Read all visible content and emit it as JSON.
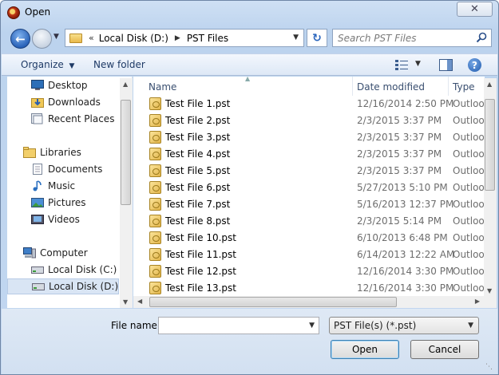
{
  "window": {
    "title": "Open",
    "close_label": "✕"
  },
  "address_bar": {
    "prefix": "«",
    "segments": [
      "Local Disk (D:)",
      "PST Files"
    ]
  },
  "search": {
    "placeholder": "Search PST Files"
  },
  "toolbar": {
    "organize_label": "Organize",
    "new_folder_label": "New folder",
    "help_label": "?"
  },
  "nav": {
    "favorites": [
      {
        "label": "Desktop",
        "icon": "desktop-icon"
      },
      {
        "label": "Downloads",
        "icon": "downloads-icon"
      },
      {
        "label": "Recent Places",
        "icon": "recent-places-icon"
      }
    ],
    "libraries": {
      "label": "Libraries",
      "items": [
        {
          "label": "Documents",
          "icon": "documents-icon"
        },
        {
          "label": "Music",
          "icon": "music-icon"
        },
        {
          "label": "Pictures",
          "icon": "pictures-icon"
        },
        {
          "label": "Videos",
          "icon": "videos-icon"
        }
      ]
    },
    "computer": {
      "label": "Computer",
      "items": [
        {
          "label": "Local Disk (C:)",
          "icon": "drive-icon"
        },
        {
          "label": "Local Disk (D:)",
          "icon": "drive-icon",
          "selected": true
        }
      ]
    }
  },
  "file_list": {
    "columns": [
      "Name",
      "Date modified",
      "Type"
    ],
    "rows": [
      {
        "name": "Test File 1.pst",
        "date": "12/16/2014 2:50 PM",
        "type": "Outloo"
      },
      {
        "name": "Test File 2.pst",
        "date": "2/3/2015 3:37 PM",
        "type": "Outloo"
      },
      {
        "name": "Test File 3.pst",
        "date": "2/3/2015 3:37 PM",
        "type": "Outloo"
      },
      {
        "name": "Test File 4.pst",
        "date": "2/3/2015 3:37 PM",
        "type": "Outloo"
      },
      {
        "name": "Test File 5.pst",
        "date": "2/3/2015 3:37 PM",
        "type": "Outloo"
      },
      {
        "name": "Test File 6.pst",
        "date": "5/27/2013 5:10 PM",
        "type": "Outloo"
      },
      {
        "name": "Test File 7.pst",
        "date": "5/16/2013 12:37 PM",
        "type": "Outloo"
      },
      {
        "name": "Test File 8.pst",
        "date": "2/3/2015 5:14 PM",
        "type": "Outloo"
      },
      {
        "name": "Test File 10.pst",
        "date": "6/10/2013 6:48 PM",
        "type": "Outloo"
      },
      {
        "name": "Test File 11.pst",
        "date": "6/14/2013 12:22 AM",
        "type": "Outloo"
      },
      {
        "name": "Test File 12.pst",
        "date": "12/16/2014 3:30 PM",
        "type": "Outloo"
      },
      {
        "name": "Test File 13.pst",
        "date": "12/16/2014 3:30 PM",
        "type": "Outloo"
      }
    ]
  },
  "footer": {
    "file_name_label": "File name:",
    "file_name_value": "",
    "file_type_value": "PST File(s) (*.pst)",
    "open_label": "Open",
    "cancel_label": "Cancel"
  }
}
